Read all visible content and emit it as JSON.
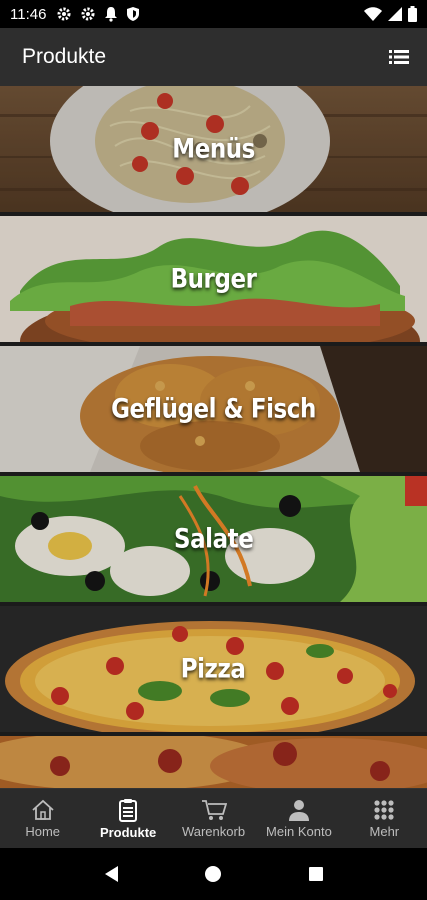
{
  "status": {
    "time": "11:46",
    "left_icons": [
      "gear-icon",
      "gear-icon",
      "bell-icon",
      "shield-icon"
    ],
    "right_icons": [
      "wifi-icon",
      "signal-icon",
      "battery-icon"
    ]
  },
  "appbar": {
    "title": "Produkte",
    "action_icon": "list-icon"
  },
  "categories": [
    {
      "label": "Menüs",
      "image": "pasta-plate"
    },
    {
      "label": "Burger",
      "image": "burger"
    },
    {
      "label": "Geflügel & Fisch",
      "image": "fried-chicken"
    },
    {
      "label": "Salate",
      "image": "salad"
    },
    {
      "label": "Pizza",
      "image": "pizza"
    },
    {
      "label": "",
      "image": "pizza-closeup"
    }
  ],
  "nav": {
    "items": [
      {
        "label": "Home",
        "icon": "home-icon"
      },
      {
        "label": "Produkte",
        "icon": "product-list-icon"
      },
      {
        "label": "Warenkorb",
        "icon": "cart-icon"
      },
      {
        "label": "Mein Konto",
        "icon": "user-icon"
      },
      {
        "label": "Mehr",
        "icon": "grid-icon"
      }
    ],
    "active_index": 1
  },
  "system_nav": [
    "back-icon",
    "home-circle-icon",
    "recents-icon"
  ]
}
